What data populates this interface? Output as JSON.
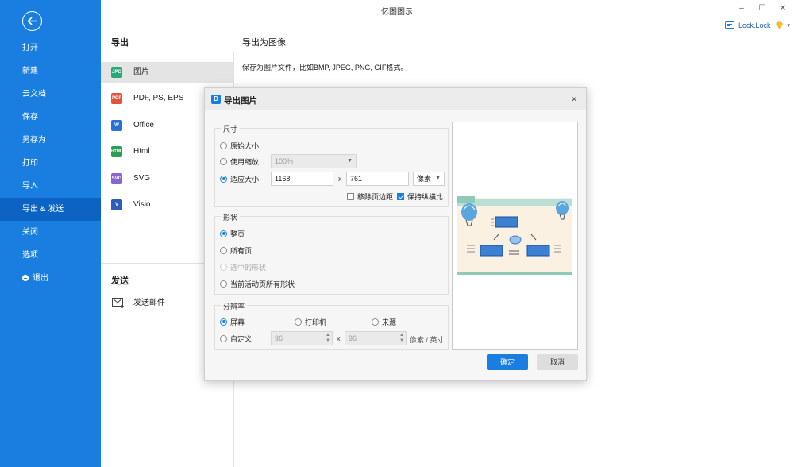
{
  "window": {
    "title": "亿图图示",
    "minimize": "–",
    "maximize": "☐",
    "close": "✕"
  },
  "user": {
    "name": "Lock.Lock"
  },
  "sidebar": {
    "items": [
      {
        "label": "打开"
      },
      {
        "label": "新建"
      },
      {
        "label": "云文档"
      },
      {
        "label": "保存"
      },
      {
        "label": "另存为"
      },
      {
        "label": "打印"
      },
      {
        "label": "导入"
      },
      {
        "label": "导出 & 发送"
      },
      {
        "label": "关闭"
      },
      {
        "label": "选项"
      },
      {
        "label": "退出"
      }
    ],
    "active_index": 7
  },
  "export": {
    "heading": "导出",
    "subheading": "导出为图像",
    "description": "保存为图片文件，比如BMP, JPEG, PNG, GIF格式。",
    "categories": [
      {
        "label": "图片",
        "icon": "jpg-icon",
        "badge": "JPG",
        "color": "#2aa87a"
      },
      {
        "label": "PDF, PS, EPS",
        "icon": "pdf-icon",
        "badge": "PDF",
        "color": "#e2533e"
      },
      {
        "label": "Office",
        "icon": "word-icon",
        "badge": "W",
        "color": "#2b6fd6"
      },
      {
        "label": "Html",
        "icon": "html-icon",
        "badge": "HTML",
        "color": "#2f9d5a"
      },
      {
        "label": "SVG",
        "icon": "svg-icon",
        "badge": "SVG",
        "color": "#8a63d2"
      },
      {
        "label": "Visio",
        "icon": "visio-icon",
        "badge": "V",
        "color": "#2d5fb8"
      }
    ]
  },
  "send": {
    "heading": "发送",
    "mail_label": "发送邮件"
  },
  "dialog": {
    "title": "导出图片",
    "size_group": {
      "title": "尺寸",
      "original_label": "原始大小",
      "zoom_label": "使用缩放",
      "zoom_value": "100%",
      "fit_label": "适应大小",
      "width": "1168",
      "height": "761",
      "x_sep": "x",
      "unit": "像素",
      "remove_margin_label": "移除页边距",
      "keep_ratio_label": "保持纵横比"
    },
    "shape_group": {
      "title": "形状",
      "whole_page": "整页",
      "all_pages": "所有页",
      "selected_shapes": "选中的形状",
      "current_page_shapes": "当前活动页所有形状"
    },
    "resolution_group": {
      "title": "分辨率",
      "screen": "屏幕",
      "printer": "打印机",
      "source": "来源",
      "custom": "自定义",
      "dpi_x": "96",
      "dpi_y": "96",
      "x_sep": "x",
      "unit": "像素 / 英寸"
    },
    "ok_label": "确定",
    "cancel_label": "取消"
  }
}
